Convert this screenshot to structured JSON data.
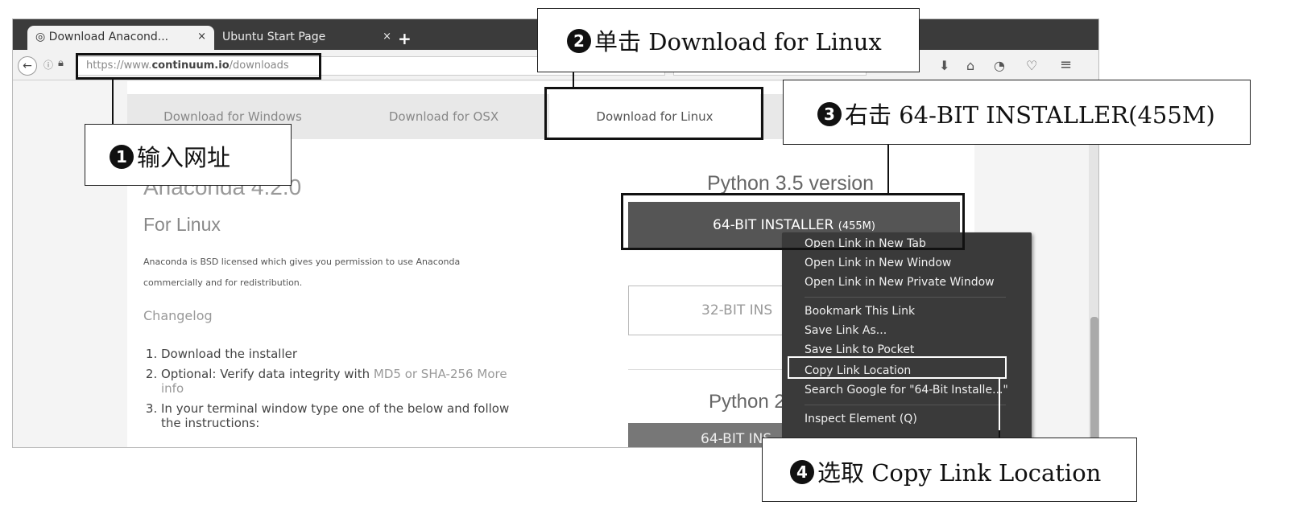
{
  "browser": {
    "tabs": [
      {
        "label": "Download Anacond...",
        "close": "×",
        "icon": "globe-icon"
      },
      {
        "label": "Ubuntu Start Page",
        "close": "×"
      }
    ],
    "new_tab": "+",
    "url_prefix": "https://www.",
    "url_domain": "continuum.io",
    "url_path": "/downloads"
  },
  "page": {
    "download_tabs": [
      "Download for Windows",
      "Download for OSX",
      "Download for Linux"
    ],
    "title": "Anaconda 4.2.0",
    "subtitle": "For Linux",
    "license": "Anaconda is BSD licensed which gives you permission to use Anaconda commercially and for redistribution.",
    "changelog": "Changelog",
    "steps": {
      "step1": "Download the installer",
      "step2_text": "Optional: Verify data integrity with ",
      "step2_links": "MD5 or SHA-256",
      "step2_more": "More info",
      "step3": "In your terminal window type one of the below and follow the instructions:"
    },
    "py35_heading": "Python 3.5 version",
    "btn64_label": "64-BIT INSTALLER",
    "btn64_size": "(455M)",
    "btn32_label": "32-BIT INS",
    "py27_heading": "Python 2",
    "btn64b_label": "64-BIT INS"
  },
  "context_menu": {
    "items": [
      "Open Link in New Tab",
      "Open Link in New Window",
      "Open Link in New Private Window",
      "Bookmark This Link",
      "Save Link As...",
      "Save Link to Pocket",
      "Copy Link Location",
      "Search Google for \"64-Bit Installe...\"",
      "Inspect Element (Q)"
    ]
  },
  "callouts": {
    "c1_num": "1",
    "c1_text": "输入网址",
    "c2_num": "2",
    "c2_text": "单击 Download for Linux",
    "c3_num": "3",
    "c3_text": "右击 64-BIT INSTALLER(455M)",
    "c4_num": "4",
    "c4_text": "选取 Copy Link Location"
  }
}
